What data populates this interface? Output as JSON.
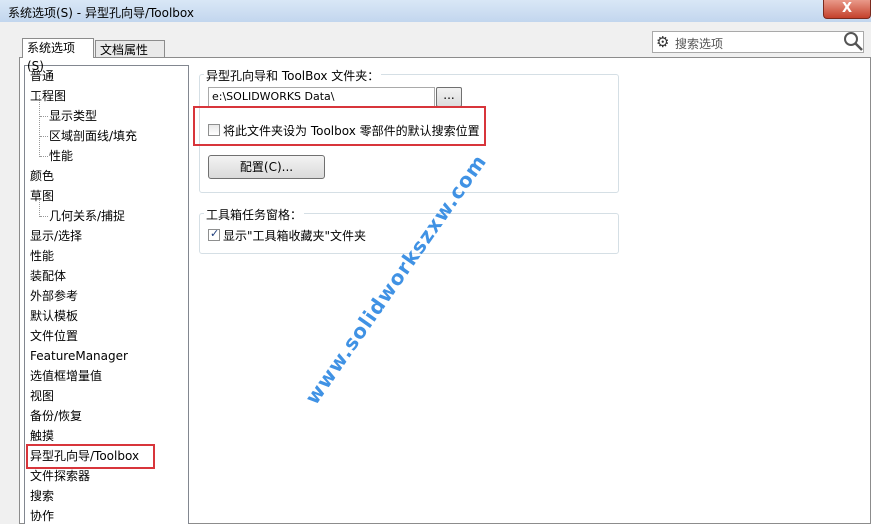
{
  "window": {
    "title": "系统选项(S) - 异型孔向导/Toolbox",
    "close_label": "X"
  },
  "tabs": [
    {
      "label": "系统选项(S)",
      "active": true
    },
    {
      "label": "文档属性(D)",
      "active": false
    }
  ],
  "search": {
    "placeholder": "搜索选项",
    "gear_icon": "gear-icon",
    "search_icon": "magnifier-icon"
  },
  "tree": {
    "items": [
      {
        "label": "普通",
        "level": 0
      },
      {
        "label": "工程图",
        "level": 0
      },
      {
        "label": "显示类型",
        "level": 1
      },
      {
        "label": "区域剖面线/填充",
        "level": 1
      },
      {
        "label": "性能",
        "level": 1
      },
      {
        "label": "颜色",
        "level": 0
      },
      {
        "label": "草图",
        "level": 0
      },
      {
        "label": "几何关系/捕捉",
        "level": 1
      },
      {
        "label": "显示/选择",
        "level": 0
      },
      {
        "label": "性能",
        "level": 0
      },
      {
        "label": "装配体",
        "level": 0
      },
      {
        "label": "外部参考",
        "level": 0
      },
      {
        "label": "默认模板",
        "level": 0
      },
      {
        "label": "文件位置",
        "level": 0
      },
      {
        "label": "FeatureManager",
        "level": 0
      },
      {
        "label": "选值框增量值",
        "level": 0
      },
      {
        "label": "视图",
        "level": 0
      },
      {
        "label": "备份/恢复",
        "level": 0
      },
      {
        "label": "触摸",
        "level": 0
      },
      {
        "label": "异型孔向导/Toolbox",
        "level": 0,
        "selected": true
      },
      {
        "label": "文件探索器",
        "level": 0
      },
      {
        "label": "搜索",
        "level": 0
      },
      {
        "label": "协作",
        "level": 0
      }
    ]
  },
  "folder_group": {
    "label": "异型孔向导和 ToolBox 文件夹：",
    "path_value": "e:\\SOLIDWORKS Data\\",
    "browse_label": "...",
    "default_search_checkbox": {
      "label": "将此文件夹设为 Toolbox 零部件的默认搜索位置",
      "checked": false
    },
    "configure_label": "配置(C)..."
  },
  "taskpane_group": {
    "label": "工具箱任务窗格：",
    "show_favorites_checkbox": {
      "label": "显示\"工具箱收藏夹\"文件夹",
      "checked": true
    }
  },
  "watermark": "www.solidworkszxw.com",
  "colors": {
    "highlight": "#d8353b",
    "watermark": "#1f7fe0"
  }
}
